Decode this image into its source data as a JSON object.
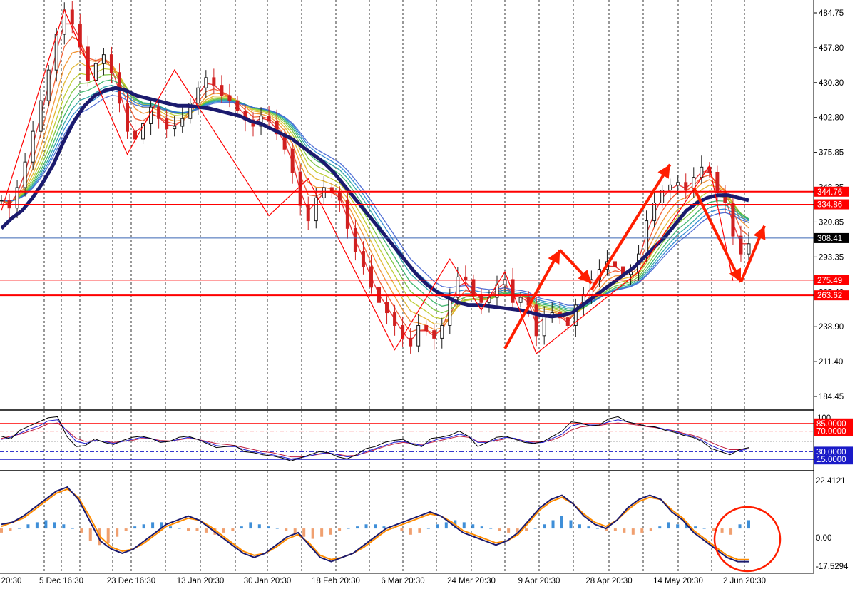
{
  "chart_data": {
    "type": "line",
    "colors": {
      "background": "#ffffff",
      "candle_bull": "#1a1a1a",
      "candle_bear": "#d02020",
      "ma_slow": "#1b1a6e",
      "level_line": "#ff0000",
      "current_line": "#3a66b5",
      "current_tag_bg": "#000000",
      "drawing": "#ff1e00",
      "stoch_main": "#000000",
      "stoch_signal": "#2020d0",
      "stoch_third": "#c02040",
      "hist_pos": "#3f8fd8",
      "hist_neg": "#f0a070",
      "macd_line1": "#1b1a6e",
      "macd_line2": "#ff8c00",
      "ma_ribbon": [
        "#e62020",
        "#f05020",
        "#f08a20",
        "#e0b020",
        "#b8c820",
        "#70c030",
        "#30b060",
        "#20a0a0",
        "#2080d0",
        "#4060d0"
      ]
    },
    "x_axis": {
      "labels": [
        "20:30",
        "5 Dec 16:30",
        "23 Dec 16:30",
        "13 Jan 20:30",
        "30 Jan 20:30",
        "18 Feb 20:30",
        "6 Mar 20:30",
        "24 Mar 20:30",
        "9 Apr 20:30",
        "28 Apr 20:30",
        "14 May 20:30",
        "2 Jun 20:30"
      ]
    },
    "price_panel": {
      "y_ticks": [
        "484.75",
        "457.80",
        "430.30",
        "402.80",
        "375.85",
        "348.35",
        "320.85",
        "293.35",
        "265.40",
        "238.90",
        "211.40",
        "184.45"
      ],
      "ylim": [
        184.45,
        484.75
      ],
      "level_lines": [
        {
          "value": 344.76,
          "label": "344.76",
          "bold": true
        },
        {
          "value": 334.86,
          "label": "334.86",
          "bold": false
        },
        {
          "value": 275.49,
          "label": "275.49",
          "bold": false
        },
        {
          "value": 263.62,
          "label": "263.62",
          "bold": true
        }
      ],
      "current_price": {
        "value": 308.41,
        "label": "308.41"
      },
      "close_series": [
        338,
        332,
        348,
        368,
        392,
        416,
        440,
        468,
        487,
        476,
        458,
        432,
        445,
        452,
        438,
        414,
        392,
        386,
        398,
        411,
        402,
        394,
        396,
        402,
        414,
        426,
        434,
        428,
        420,
        416,
        408,
        401,
        396,
        404,
        400,
        390,
        378,
        360,
        334,
        322,
        340,
        348,
        344,
        338,
        316,
        298,
        286,
        270,
        258,
        250,
        240,
        230,
        224,
        240,
        236,
        230,
        240,
        262,
        278,
        276,
        264,
        258,
        262,
        272,
        276,
        258,
        262,
        256,
        232,
        248,
        250,
        246,
        240,
        256,
        264,
        276,
        284,
        290,
        286,
        280,
        282,
        296,
        322,
        336,
        346,
        350,
        352,
        346,
        356,
        364,
        360,
        344,
        336,
        310,
        296,
        304
      ],
      "slow_ma": [
        316,
        324,
        330,
        340,
        352,
        366,
        384,
        400,
        412,
        420,
        424,
        426,
        424,
        420,
        418,
        416,
        414,
        412,
        412,
        411,
        410,
        408,
        406,
        404,
        400,
        398,
        394,
        390,
        386,
        380,
        374,
        368,
        360,
        350,
        340,
        330,
        320,
        310,
        300,
        290,
        280,
        272,
        266,
        262,
        258,
        256,
        256,
        255,
        254,
        253,
        252,
        250,
        248,
        247,
        248,
        250,
        256,
        262,
        268,
        274,
        280,
        286,
        294,
        302,
        310,
        320,
        330,
        336,
        340,
        342,
        342,
        340,
        338
      ],
      "zigzag": [
        {
          "i": 0,
          "v": 330
        },
        {
          "i": 8,
          "v": 487
        },
        {
          "i": 16,
          "v": 374
        },
        {
          "i": 22,
          "v": 440
        },
        {
          "i": 34,
          "v": 326
        },
        {
          "i": 39,
          "v": 355
        },
        {
          "i": 50,
          "v": 221
        },
        {
          "i": 57,
          "v": 292
        },
        {
          "i": 61,
          "v": 252
        },
        {
          "i": 64,
          "v": 282
        },
        {
          "i": 68,
          "v": 218
        },
        {
          "i": 81,
          "v": 282
        },
        {
          "i": 90,
          "v": 365
        },
        {
          "i": 93,
          "v": 275
        }
      ]
    },
    "stoch_panel": {
      "y_ticks": [
        "100",
        "50"
      ],
      "levels": [
        {
          "value": 85,
          "label": "85.0000"
        },
        {
          "value": 70,
          "label": "70.0000"
        },
        {
          "value": 30,
          "label": "30.0000"
        },
        {
          "value": 15,
          "label": "15.0000"
        }
      ],
      "ylim": [
        0,
        100
      ],
      "main": [
        60,
        55,
        72,
        80,
        88,
        96,
        98,
        60,
        40,
        42,
        55,
        48,
        44,
        52,
        58,
        60,
        56,
        48,
        50,
        58,
        60,
        54,
        46,
        38,
        40,
        42,
        30,
        28,
        24,
        22,
        18,
        12,
        18,
        24,
        30,
        28,
        20,
        16,
        24,
        36,
        40,
        48,
        52,
        54,
        44,
        40,
        56,
        58,
        62,
        70,
        60,
        40,
        48,
        58,
        60,
        54,
        48,
        46,
        50,
        60,
        70,
        88,
        86,
        80,
        82,
        94,
        98,
        88,
        84,
        80,
        78,
        72,
        68,
        62,
        58,
        50,
        36,
        30,
        24,
        34,
        38
      ],
      "signal": [
        54,
        58,
        66,
        74,
        80,
        90,
        92,
        70,
        50,
        46,
        52,
        50,
        46,
        50,
        54,
        58,
        56,
        50,
        50,
        54,
        58,
        54,
        48,
        42,
        40,
        40,
        34,
        30,
        27,
        24,
        20,
        16,
        18,
        22,
        26,
        28,
        24,
        20,
        22,
        30,
        36,
        42,
        48,
        50,
        46,
        42,
        50,
        56,
        58,
        64,
        60,
        48,
        48,
        54,
        58,
        56,
        50,
        47,
        48,
        56,
        64,
        80,
        84,
        82,
        82,
        88,
        92,
        88,
        84,
        80,
        78,
        74,
        70,
        64,
        60,
        52,
        42,
        34,
        28,
        32,
        36
      ],
      "third": [
        56,
        60,
        64,
        70,
        76,
        84,
        86,
        72,
        56,
        50,
        52,
        50,
        48,
        50,
        52,
        56,
        55,
        52,
        51,
        53,
        56,
        54,
        50,
        46,
        44,
        42,
        38,
        34,
        30,
        28,
        24,
        20,
        20,
        22,
        25,
        27,
        25,
        22,
        23,
        28,
        34,
        40,
        45,
        48,
        46,
        44,
        48,
        52,
        56,
        60,
        58,
        50,
        49,
        52,
        55,
        55,
        51,
        49,
        49,
        53,
        60,
        72,
        78,
        80,
        81,
        84,
        86,
        84,
        82,
        79,
        77,
        74,
        71,
        66,
        62,
        56,
        48,
        40,
        34,
        34,
        36
      ]
    },
    "macd_panel": {
      "y_ticks": [
        "22.4121",
        "0.00",
        "-17.5294"
      ],
      "ylim": [
        -17.5294,
        22.4121
      ],
      "histogram": [
        -2,
        -1,
        0,
        2,
        3,
        4,
        3,
        2,
        0,
        -2,
        -6,
        -8,
        -7,
        -4,
        -1,
        1,
        2,
        3,
        3,
        1,
        0,
        -1,
        -1,
        -2,
        -3,
        -2,
        -1,
        1,
        3,
        2,
        1,
        0,
        -1,
        -3,
        -4,
        -5,
        -4,
        -3,
        -1,
        0,
        1,
        2,
        2,
        1,
        0,
        -1,
        -3,
        -2,
        0,
        2,
        3,
        4,
        3,
        2,
        1,
        0,
        -1,
        -2,
        -2,
        -1,
        0,
        2,
        4,
        6,
        4,
        2,
        1,
        0,
        -1,
        -1,
        -2,
        -3,
        -2,
        -1,
        1,
        3,
        2,
        3,
        1,
        0,
        -1,
        -2,
        -3,
        2,
        4
      ],
      "line1": [
        2,
        3,
        6,
        10,
        14,
        18,
        20,
        14,
        4,
        -6,
        -10,
        -12,
        -10,
        -6,
        -2,
        2,
        4,
        6,
        4,
        0,
        -4,
        -8,
        -12,
        -14,
        -12,
        -8,
        -4,
        -2,
        -8,
        -14,
        -16,
        -14,
        -12,
        -8,
        -4,
        0,
        2,
        4,
        6,
        8,
        6,
        2,
        -2,
        -4,
        -6,
        -8,
        -6,
        -2,
        4,
        10,
        14,
        16,
        12,
        6,
        2,
        0,
        4,
        10,
        14,
        16,
        14,
        8,
        4,
        -2,
        -6,
        -10,
        -14,
        -16,
        -16
      ],
      "line2": [
        1,
        3,
        5,
        9,
        13,
        17,
        19,
        15,
        6,
        -4,
        -9,
        -11,
        -10,
        -7,
        -3,
        1,
        3,
        5,
        4,
        1,
        -3,
        -7,
        -11,
        -13,
        -12,
        -9,
        -5,
        -3,
        -7,
        -13,
        -15,
        -14,
        -12,
        -9,
        -5,
        -1,
        1,
        3,
        5,
        7,
        6,
        3,
        -1,
        -3,
        -5,
        -7,
        -6,
        -3,
        3,
        9,
        13,
        15,
        12,
        7,
        3,
        1,
        4,
        9,
        13,
        15,
        14,
        9,
        5,
        -1,
        -5,
        -9,
        -13,
        -15,
        -15
      ]
    },
    "arrows": [
      {
        "from_i": 64,
        "from_v": 222,
        "to_i": 71,
        "to_v": 299
      },
      {
        "from_i": 71,
        "from_v": 299,
        "to_i": 75,
        "to_v": 273
      },
      {
        "from_i": 75,
        "from_v": 268,
        "to_i": 85,
        "to_v": 366
      },
      {
        "from_i": 88,
        "from_v": 348,
        "to_i": 94,
        "to_v": 274
      },
      {
        "from_i": 94,
        "from_v": 274,
        "to_i": 97,
        "to_v": 318
      }
    ]
  }
}
